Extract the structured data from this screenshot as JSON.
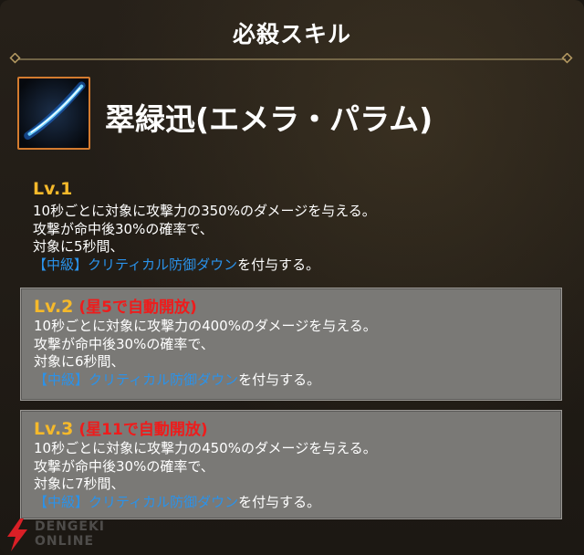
{
  "header": {
    "title": "必殺スキル"
  },
  "skill": {
    "icon": "blue-slash-icon",
    "name": "翠緑迅(エメラ・パラム)"
  },
  "levels": [
    {
      "label": "Lv.1",
      "unlock": "",
      "line1": "10秒ごとに対象に攻撃力の350%のダメージを与える。",
      "line2": "攻撃が命中後30%の確率で、",
      "line3": "対象に5秒間、",
      "effect": "【中級】クリティカル防御ダウン",
      "suffix": "を付与する。"
    },
    {
      "label": "Lv.2",
      "unlock": "(星5で自動開放)",
      "line1": "10秒ごとに対象に攻撃力の400%のダメージを与える。",
      "line2": "攻撃が命中後30%の確率で、",
      "line3": "対象に6秒間、",
      "effect": "【中級】クリティカル防御ダウン",
      "suffix": "を付与する。"
    },
    {
      "label": "Lv.3",
      "unlock": "(星11で自動開放)",
      "line1": "10秒ごとに対象に攻撃力の450%のダメージを与える。",
      "line2": "攻撃が命中後30%の確率で、",
      "line3": "対象に7秒間、",
      "effect": "【中級】クリティカル防御ダウン",
      "suffix": "を付与する。"
    }
  ],
  "watermark": {
    "line1": "DENGEKI",
    "line2": "ONLINE"
  },
  "colors": {
    "level_label": "#f5b92b",
    "unlock_text": "#ee1c1c",
    "effect_text": "#2a92ea",
    "icon_border": "#d47b2f",
    "level_box": "#7a7976"
  }
}
